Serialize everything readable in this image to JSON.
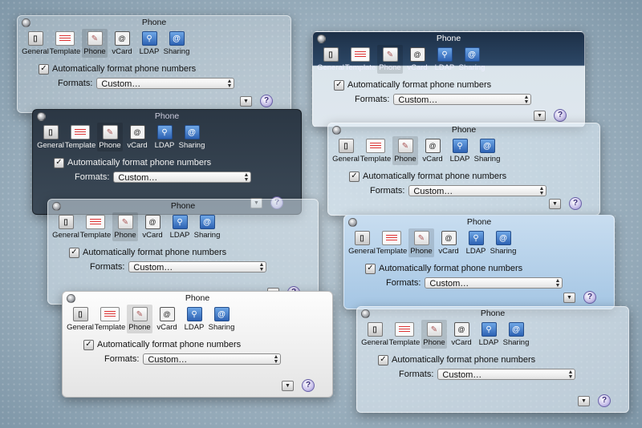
{
  "window": {
    "title": "Phone",
    "toolbar": [
      {
        "label": "General",
        "icon": "general-icon"
      },
      {
        "label": "Template",
        "icon": "template-icon"
      },
      {
        "label": "Phone",
        "icon": "phone-icon"
      },
      {
        "label": "vCard",
        "icon": "vcard-icon"
      },
      {
        "label": "LDAP",
        "icon": "ldap-icon"
      },
      {
        "label": "Sharing",
        "icon": "sharing-icon"
      }
    ],
    "auto_format_label": "Automatically format phone numbers",
    "auto_format_checked": true,
    "formats_label": "Formats:",
    "formats_value": "Custom…",
    "help_label": "?"
  }
}
